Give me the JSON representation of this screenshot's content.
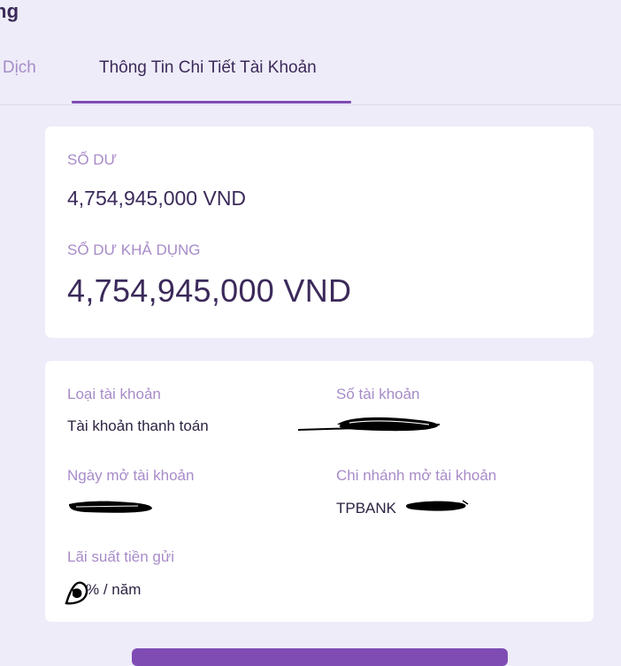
{
  "header": {
    "title": "ng"
  },
  "tabs": [
    {
      "label": "o Dịch"
    },
    {
      "label": "Thông Tin Chi Tiết Tài Khoản"
    }
  ],
  "balance": {
    "label": "SỐ DƯ",
    "value": "4,754,945,000 VND",
    "available_label": "SỐ DƯ KHẢ DỤNG",
    "available_value": "4,754,945,000 VND"
  },
  "details": {
    "account_type_label": "Loại tài khoản",
    "account_type_value": "Tài khoản thanh toán",
    "account_number_label": "Số tài khoản",
    "open_date_label": "Ngày mở tài khoản",
    "branch_label": "Chi nhánh mở tài khoản",
    "branch_value": "TPBANK",
    "interest_label": "Lãi suất tiền gửi",
    "interest_value": "% / năm"
  },
  "colors": {
    "accent": "#7f4cb4",
    "background": "#efecf9",
    "label": "#a78bc8",
    "text_dark": "#3b2a5a"
  }
}
